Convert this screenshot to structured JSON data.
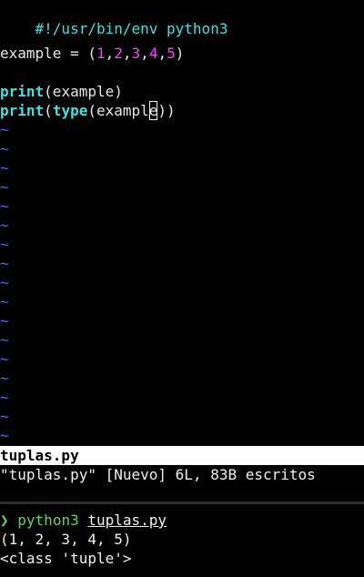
{
  "editor": {
    "lines": [
      {
        "shebang": "#!/usr/bin/env python3"
      },
      {},
      {
        "assign": {
          "name": "example",
          "op": " = (",
          "nums": [
            "1",
            "2",
            "3",
            "4",
            "5"
          ],
          "sep": ",",
          "close": ")"
        }
      },
      {},
      {
        "call1": {
          "kw": "print",
          "arg": "(example)"
        }
      },
      {
        "call2": {
          "kw1": "print",
          "paren1": "(",
          "kw2": "type",
          "arg_before": "(exampl",
          "cursor_char": "e",
          "arg_after": "))"
        }
      }
    ],
    "tilde": "~"
  },
  "statusbar": {
    "filename": "tuplas.py"
  },
  "message": "\"tuplas.py\" [Nuevo] 6L, 83B escritos",
  "terminal": {
    "prompt_symbol": "❯",
    "command": "python3",
    "argument": "tuplas.py",
    "output": [
      "(1, 2, 3, 4, 5)",
      "<class 'tuple'>"
    ]
  }
}
